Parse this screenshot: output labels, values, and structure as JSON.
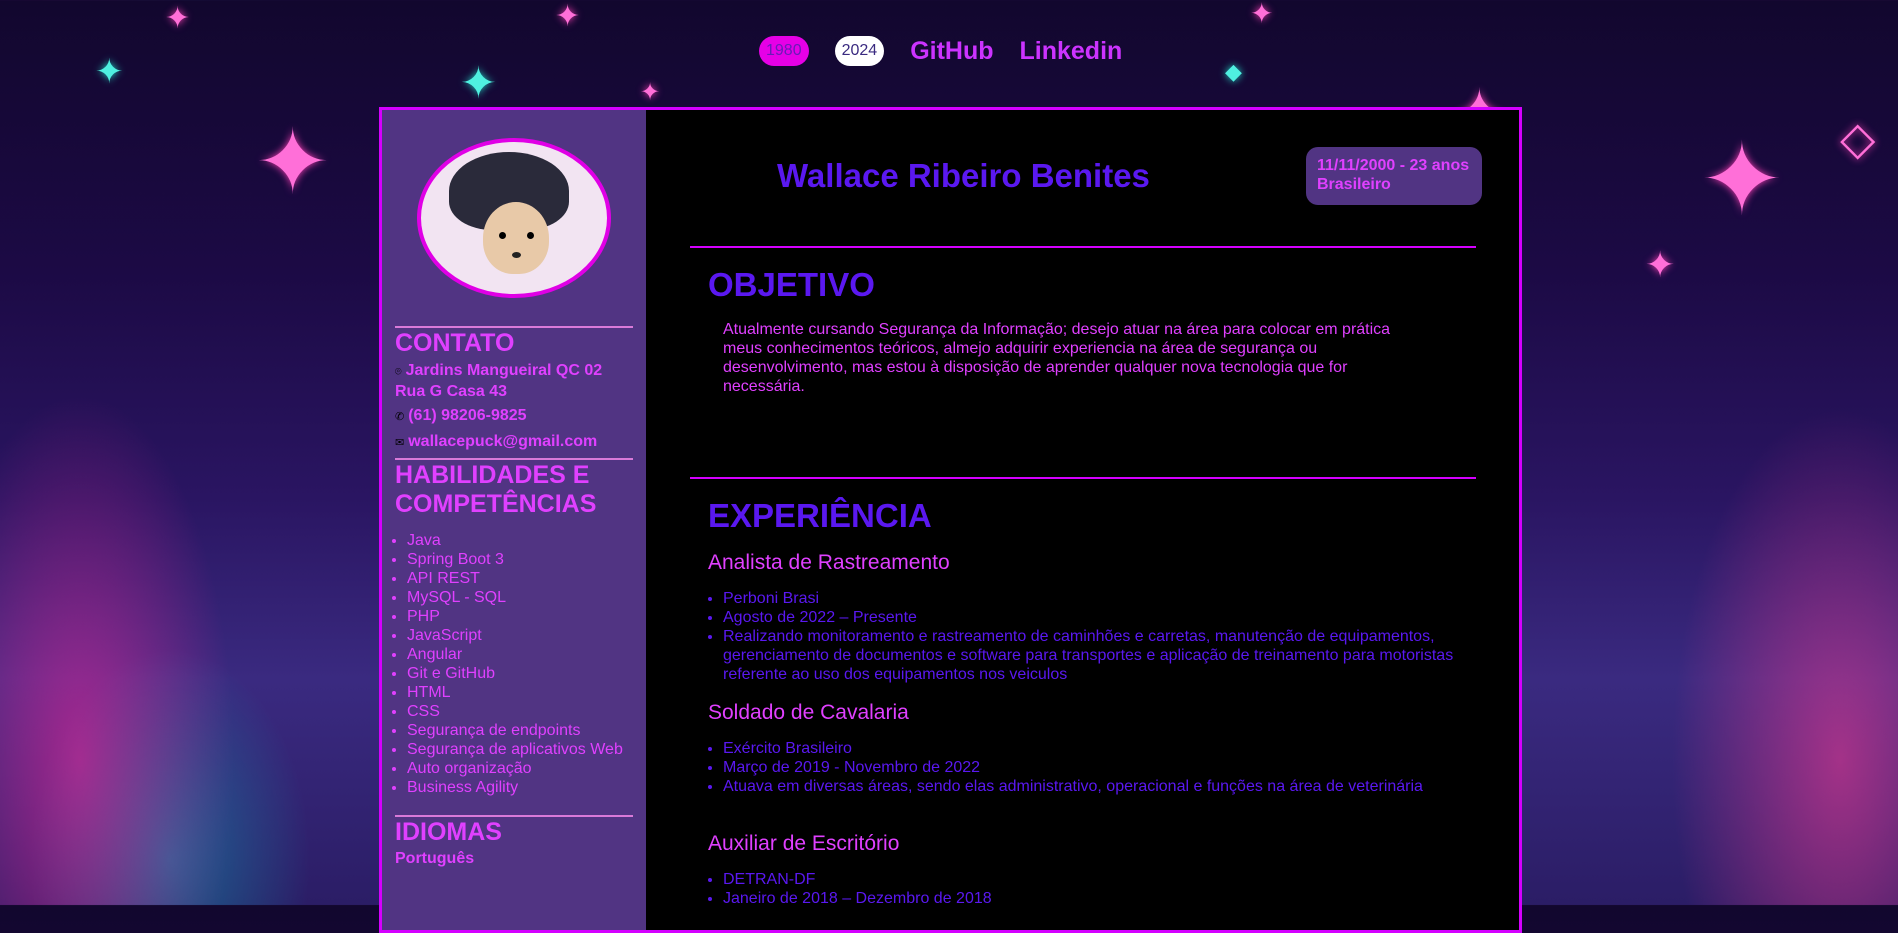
{
  "nav": {
    "pill_1": "1980",
    "pill_2": "2024",
    "github_label": "GitHub",
    "linkedin_label": "Linkedin"
  },
  "header": {
    "name": "Wallace Ribeiro Benites",
    "birth": "11/11/2000 - 23 anos",
    "nationality": "Brasileiro"
  },
  "sidebar": {
    "contact_title": "CONTATO",
    "address": "Jardins Mangueiral QC 02 Rua G Casa 43",
    "phone": "(61) 98206-9825",
    "email": "wallacepuck@gmail.com",
    "skills_title": "HABILIDADES E COMPETÊNCIAS",
    "skills": [
      "Java",
      "Spring Boot 3",
      "API REST",
      "MySQL - SQL",
      "PHP",
      "JavaScript",
      "Angular",
      "Git e GitHub",
      "HTML",
      "CSS",
      "Segurança de endpoints",
      "Segurança de aplicativos Web",
      "Auto organização",
      "Business Agility"
    ],
    "languages_title": "IDIOMAS",
    "language_1": "Português"
  },
  "objective": {
    "title": "OBJETIVO",
    "text": "Atualmente cursando Segurança da Informação; desejo atuar na área para colocar em prática meus conhecimentos teóricos, almejo adquirir experiencia na área de segurança ou desenvolvimento, mas estou à disposição de aprender qualquer nova tecnologia que for necessária."
  },
  "experience": {
    "title": "EXPERIÊNCIA",
    "jobs": [
      {
        "role": "Analista de Rastreamento",
        "company": "Perboni Brasi",
        "period": "Agosto de 2022 – Presente",
        "description": "Realizando monitoramento e rastreamento de caminhões e carretas, manutenção de equipamentos, gerenciamento de documentos e software para transportes e aplicação de treinamento para motoristas referente ao uso dos equipamentos nos veiculos"
      },
      {
        "role": "Soldado de Cavalaria",
        "company": "Exército Brasileiro",
        "period": "Março de 2019 - Novembro de 2022",
        "description": "Atuava em diversas áreas, sendo elas administrativo, operacional e funções na área de veterinária"
      },
      {
        "role": "Auxiliar de Escritório",
        "company": "DETRAN-DF",
        "period": "Janeiro de 2018 – Dezembro de 2018"
      }
    ]
  },
  "colors": {
    "accent_magenta": "#d400ff",
    "heading_violet": "#5a18f0",
    "sidebar_purple": "#513483",
    "text_pink": "#e040ff"
  }
}
